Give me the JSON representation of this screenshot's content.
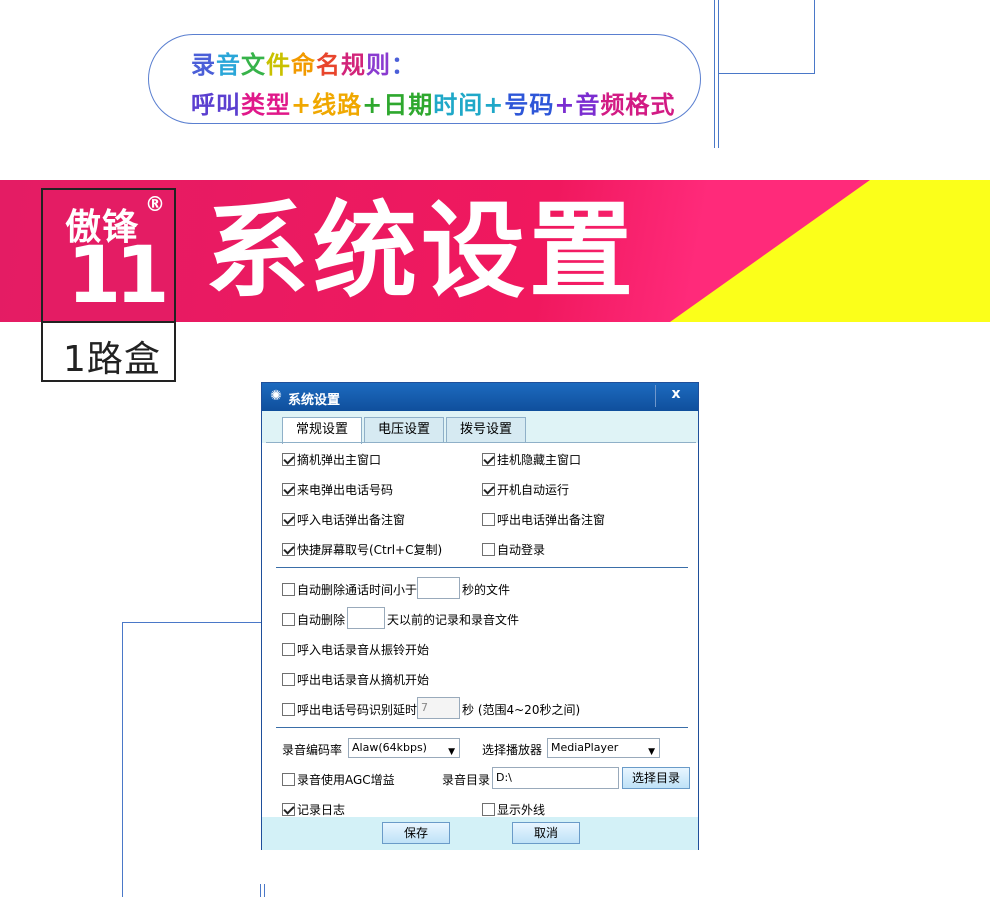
{
  "rule": {
    "title": "录音文件命名规则：",
    "body": [
      {
        "text": "呼叫",
        "color": "#5b3fd0"
      },
      {
        "text": "类型",
        "color": "#e0188a"
      },
      {
        "text": "+",
        "color": "#f0a800"
      },
      {
        "text": "线路",
        "color": "#f0a800"
      },
      {
        "text": "+",
        "color": "#2ea82e"
      },
      {
        "text": "日期",
        "color": "#2ea82e"
      },
      {
        "text": "时间",
        "color": "#1fa8c8"
      },
      {
        "text": "+",
        "color": "#1fa8c8"
      },
      {
        "text": "号码",
        "color": "#2d56d8"
      },
      {
        "text": "+",
        "color": "#7b2dd0"
      },
      {
        "text": "音",
        "color": "#7b2dd0"
      },
      {
        "text": "频格式",
        "color": "#d21b84"
      }
    ],
    "title_colors": [
      "#4b5fd8",
      "#2aa6d8",
      "#37b34a",
      "#c9c100",
      "#f29a00",
      "#e8452c",
      "#d2247a",
      "#8a3bd0",
      "#4b5fd8"
    ]
  },
  "banner": {
    "title": "系统设置"
  },
  "logo": {
    "name": "傲锋",
    "reg": "®",
    "number": "11",
    "subtitle": "1路盒"
  },
  "dialog": {
    "title": "系统设置",
    "close": "x",
    "tabs": [
      {
        "label": "常规设置",
        "active": true
      },
      {
        "label": "电压设置",
        "active": false
      },
      {
        "label": "拨号设置",
        "active": false
      }
    ],
    "options": [
      {
        "label": "摘机弹出主窗口",
        "checked": true
      },
      {
        "label": "挂机隐藏主窗口",
        "checked": true
      },
      {
        "label": "来电弹出电话号码",
        "checked": true
      },
      {
        "label": "开机自动运行",
        "checked": true
      },
      {
        "label": "呼入电话弹出备注窗",
        "checked": true
      },
      {
        "label": "呼出电话弹出备注窗",
        "checked": false
      },
      {
        "label": "快捷屏幕取号(Ctrl+C复制)",
        "checked": true
      },
      {
        "label": "自动登录",
        "checked": false
      }
    ],
    "auto_delete_short": {
      "prefix": "自动删除通话时间小于",
      "value": "",
      "suffix": "秒的文件",
      "checked": false
    },
    "auto_delete_old": {
      "prefix": "自动删除",
      "value": "",
      "suffix": "天以前的记录和录音文件",
      "checked": false
    },
    "record_from_ring": {
      "label": "呼入电话录音从振铃开始",
      "checked": false
    },
    "record_from_offhook": {
      "label": "呼出电话录音从摘机开始",
      "checked": false
    },
    "detect_delay": {
      "prefix": "呼出电话号码识别延时",
      "value": "7",
      "suffix": "秒 (范围4~20秒之间)",
      "checked": false
    },
    "encoding": {
      "label": "录音编码率",
      "value": "Alaw(64kbps)"
    },
    "player": {
      "label": "选择播放器",
      "value": "MediaPlayer"
    },
    "agc": {
      "label": "录音使用AGC增益",
      "checked": false
    },
    "record_dir": {
      "label": "录音目录",
      "value": "D:\\",
      "button": "选择目录"
    },
    "log": {
      "label": "记录日志",
      "checked": true
    },
    "show_line": {
      "label": "显示外线",
      "checked": false
    },
    "save": "保存",
    "cancel": "取消"
  }
}
